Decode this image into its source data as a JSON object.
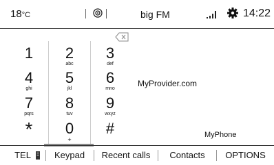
{
  "status": {
    "temp_value": "18",
    "temp_unit": "°C",
    "station": "big FM",
    "time": "14:22"
  },
  "keypad": {
    "keys": [
      {
        "digit": "1",
        "letters": ""
      },
      {
        "digit": "2",
        "letters": "abc"
      },
      {
        "digit": "3",
        "letters": "def"
      },
      {
        "digit": "4",
        "letters": "ghi"
      },
      {
        "digit": "5",
        "letters": "jkl"
      },
      {
        "digit": "6",
        "letters": "mno"
      },
      {
        "digit": "7",
        "letters": "pqrs"
      },
      {
        "digit": "8",
        "letters": "tuv"
      },
      {
        "digit": "9",
        "letters": "wxyz"
      },
      {
        "digit": "*",
        "letters": ""
      },
      {
        "digit": "0",
        "letters": "+"
      },
      {
        "digit": "#",
        "letters": ""
      }
    ]
  },
  "info": {
    "provider": "MyProvider.com",
    "phone_name": "MyPhone"
  },
  "bottom": {
    "tel": "TEL",
    "tabs": [
      "Keypad",
      "Recent calls",
      "Contacts",
      "OPTIONS"
    ],
    "active_tab": "Keypad"
  }
}
